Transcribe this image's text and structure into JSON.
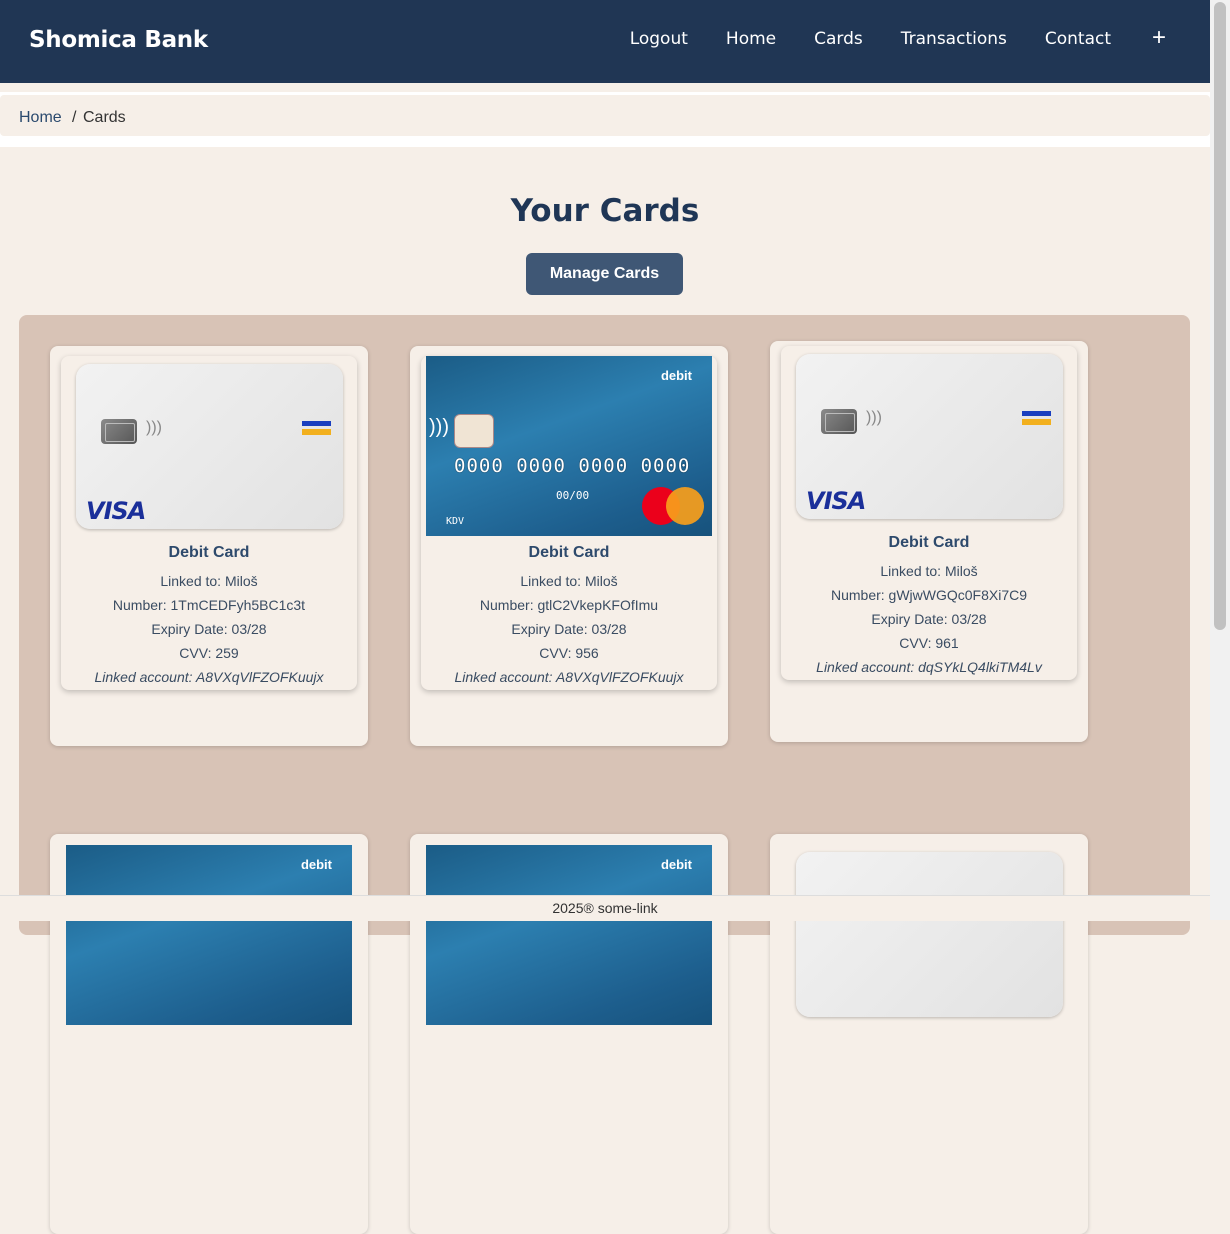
{
  "nav": {
    "brand": "Shomica Bank",
    "links": [
      "Logout",
      "Home",
      "Cards",
      "Transactions",
      "Contact"
    ],
    "plus": "+"
  },
  "breadcrumb": {
    "home": "Home",
    "separator": "/",
    "current": "Cards"
  },
  "main": {
    "title": "Your Cards",
    "manage_button": "Manage Cards"
  },
  "cards": [
    {
      "type": "Debit Card",
      "linked_to": "Linked to: Miloš",
      "number": "Number: 1TmCEDFyh5BC1c3t",
      "expiry": "Expiry Date: 03/28",
      "cvv": "CVV: 259",
      "account": "Linked account: A8VXqVlFZOFKuujx",
      "art": "visa"
    },
    {
      "type": "Debit Card",
      "linked_to": "Linked to: Miloš",
      "number": "Number: gtlC2VkepKFOfImu",
      "expiry": "Expiry Date: 03/28",
      "cvv": "CVV: 956",
      "account": "Linked account: A8VXqVlFZOFKuujx",
      "art": "mastercard"
    },
    {
      "type": "Debit Card",
      "linked_to": "Linked to: Miloš",
      "number": "Number: gWjwWGQc0F8Xi7C9",
      "expiry": "Expiry Date: 03/28",
      "cvv": "CVV: 961",
      "account": "Linked account: dqSYkLQ4lkiTM4Lv",
      "art": "visa"
    }
  ],
  "card_art": {
    "visa_logo": "VISA",
    "mc_label": "debit",
    "mc_number": "0000 0000 0000 0000",
    "mc_expiry": "00/00",
    "mc_name": "KDV"
  },
  "footer": {
    "text": "2025® some-link"
  }
}
